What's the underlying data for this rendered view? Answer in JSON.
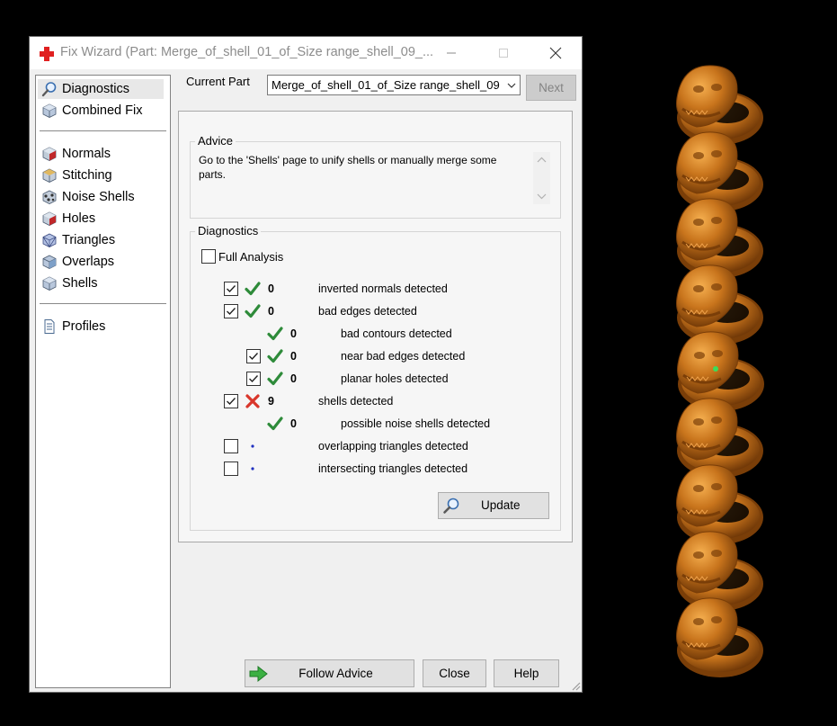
{
  "window": {
    "title": "Fix Wizard (Part: Merge_of_shell_01_of_Size range_shell_09_...",
    "controls": {
      "minimize": "minimize",
      "maximize": "maximize",
      "close": "close"
    }
  },
  "nav": {
    "items_top": [
      {
        "label": "Diagnostics",
        "icon": "magnifier-icon",
        "selected": true
      },
      {
        "label": "Combined Fix",
        "icon": "cube-icon",
        "selected": false
      }
    ],
    "items_fix": [
      {
        "label": "Normals",
        "icon": "normals-cube-icon"
      },
      {
        "label": "Stitching",
        "icon": "stitching-cube-icon"
      },
      {
        "label": "Noise Shells",
        "icon": "noise-shells-icon"
      },
      {
        "label": "Holes",
        "icon": "holes-cube-icon"
      },
      {
        "label": "Triangles",
        "icon": "triangles-cube-icon"
      },
      {
        "label": "Overlaps",
        "icon": "overlaps-cube-icon"
      },
      {
        "label": "Shells",
        "icon": "shells-cube-icon"
      }
    ],
    "items_bottom": [
      {
        "label": "Profiles",
        "icon": "document-icon"
      }
    ]
  },
  "current_part": {
    "label": "Current Part",
    "value": "Merge_of_shell_01_of_Size range_shell_09",
    "next_label": "Next"
  },
  "advice": {
    "legend": "Advice",
    "text": "Go to the 'Shells' page to unify shells or manually merge some parts."
  },
  "diagnostics": {
    "legend": "Diagnostics",
    "full_analysis_label": "Full Analysis",
    "full_analysis_checked": false,
    "rows": [
      {
        "checkbox": true,
        "checked": true,
        "status": "ok",
        "count": "0",
        "label": "inverted normals detected",
        "indent": false
      },
      {
        "checkbox": true,
        "checked": true,
        "status": "ok",
        "count": "0",
        "label": "bad edges detected",
        "indent": false
      },
      {
        "checkbox": false,
        "checked": false,
        "status": "ok",
        "count": "0",
        "label": "bad contours detected",
        "indent": true
      },
      {
        "checkbox": true,
        "checked": true,
        "status": "ok",
        "count": "0",
        "label": "near bad edges detected",
        "indent": true
      },
      {
        "checkbox": true,
        "checked": true,
        "status": "ok",
        "count": "0",
        "label": "planar holes detected",
        "indent": true
      },
      {
        "checkbox": true,
        "checked": true,
        "status": "error",
        "count": "9",
        "label": "shells detected",
        "indent": false
      },
      {
        "checkbox": false,
        "checked": false,
        "status": "ok",
        "count": "0",
        "label": "possible noise shells detected",
        "indent": true
      },
      {
        "checkbox": true,
        "checked": false,
        "status": "pending",
        "count": "",
        "label": "overlapping triangles detected",
        "indent": false
      },
      {
        "checkbox": true,
        "checked": false,
        "status": "pending",
        "count": "",
        "label": "intersecting triangles detected",
        "indent": false
      }
    ],
    "update_label": "Update"
  },
  "footer": {
    "follow_advice_label": "Follow Advice",
    "close_label": "Close",
    "help_label": "Help"
  },
  "viewport": {
    "object": "stacked-ring-models",
    "ring_count": 9,
    "colors": {
      "ring": "#c8741c",
      "ring_dark": "#7a3e08",
      "ring_light": "#f0a24a",
      "background": "#000000"
    }
  },
  "colors": {
    "ok_check": "#2e8b3a",
    "error_x": "#d9362b",
    "pending_dot": "#2030c0"
  }
}
